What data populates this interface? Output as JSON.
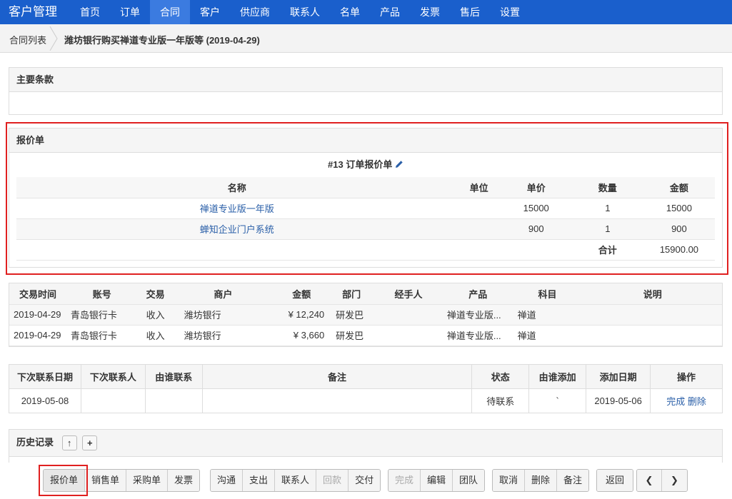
{
  "nav": {
    "brand": "客户管理",
    "items": [
      "首页",
      "订单",
      "合同",
      "客户",
      "供应商",
      "联系人",
      "名单",
      "产品",
      "发票",
      "售后",
      "设置"
    ],
    "active_index": 2
  },
  "breadcrumb": {
    "parent": "合同列表",
    "current": "潍坊银行购买禅道专业版一年版等 (2019-04-29)"
  },
  "terms": {
    "title": "主要条款"
  },
  "quote": {
    "panel_title": "报价单",
    "order_title": "#13 订单报价单",
    "headers": [
      "名称",
      "单位",
      "单价",
      "数量",
      "金额"
    ],
    "rows": [
      {
        "name": "禅道专业版一年版",
        "unit": "",
        "price": "15000",
        "qty": "1",
        "amount": "15000"
      },
      {
        "name": "蝉知企业门户系统",
        "unit": "",
        "price": "900",
        "qty": "1",
        "amount": "900"
      }
    ],
    "total_label": "合计",
    "total_value": "15900.00"
  },
  "transactions": {
    "headers": [
      "交易时间",
      "账号",
      "交易",
      "商户",
      "金额",
      "部门",
      "经手人",
      "产品",
      "科目",
      "说明"
    ],
    "rows": [
      [
        "2019-04-29",
        "青岛银行卡",
        "收入",
        "潍坊银行",
        "¥ 12,240",
        "研发巴",
        "",
        "禅道专业版...",
        "禅道",
        ""
      ],
      [
        "2019-04-29",
        "青岛银行卡",
        "收入",
        "潍坊银行",
        "¥ 3,660",
        "研发巴",
        "",
        "禅道专业版...",
        "禅道",
        ""
      ]
    ]
  },
  "followup": {
    "headers": [
      "下次联系日期",
      "下次联系人",
      "由谁联系",
      "备注",
      "状态",
      "由谁添加",
      "添加日期",
      "操作"
    ],
    "rows": [
      {
        "date": "2019-05-08",
        "contact": "",
        "by": "",
        "note": "",
        "status": "待联系",
        "added_by": "`",
        "added_date": "2019-05-06",
        "op_complete": "完成",
        "op_delete": "删除"
      }
    ]
  },
  "history": {
    "title": "历史记录",
    "up_icon": "↑",
    "plus_icon": "+"
  },
  "toolbar": {
    "group1": [
      "报价单",
      "销售单",
      "采购单",
      "发票"
    ],
    "group2": [
      "沟通",
      "支出",
      "联系人",
      "回款",
      "交付"
    ],
    "group3": [
      "完成",
      "编辑",
      "团队"
    ],
    "group4": [
      "取消",
      "删除",
      "备注"
    ],
    "back": "返回",
    "prev": "❮",
    "next": "❯"
  },
  "colors": {
    "nav": "#1a5fcc",
    "nav_active": "#3b7be0",
    "highlight": "#e02020",
    "link": "#2a5fa8"
  }
}
